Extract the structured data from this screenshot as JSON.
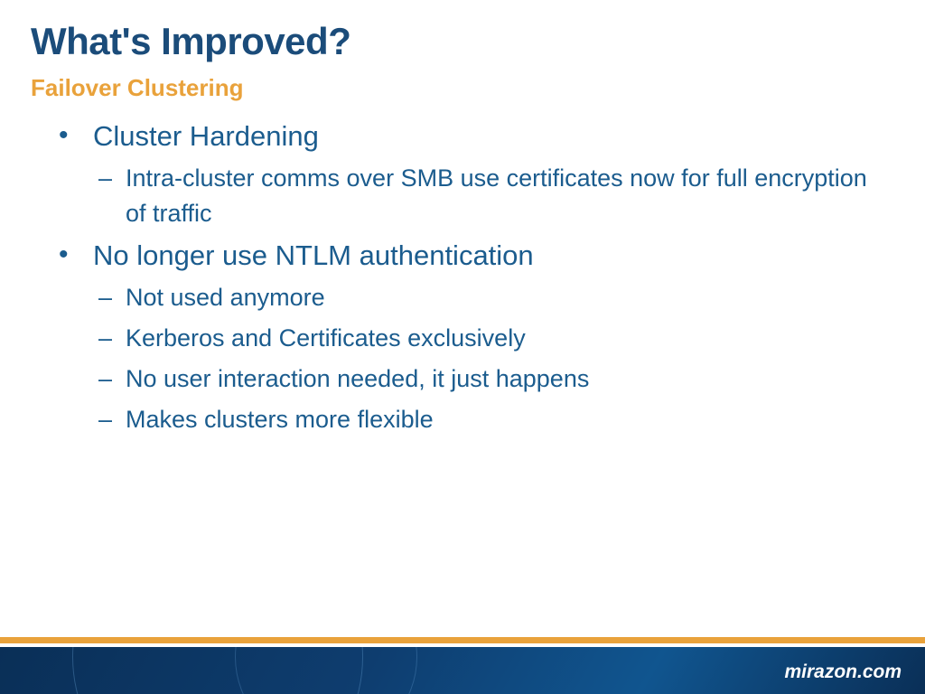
{
  "title": "What's Improved?",
  "subtitle": "Failover Clustering",
  "bullets": [
    {
      "text": "Cluster Hardening",
      "sub": [
        "Intra-cluster comms over SMB use certificates now for full encryption of traffic"
      ]
    },
    {
      "text": "No longer use NTLM authentication",
      "sub": [
        "Not used anymore",
        "Kerberos and Certificates exclusively",
        "No user interaction needed, it just happens",
        "Makes clusters more flexible"
      ]
    }
  ],
  "footer": "mirazon.com"
}
